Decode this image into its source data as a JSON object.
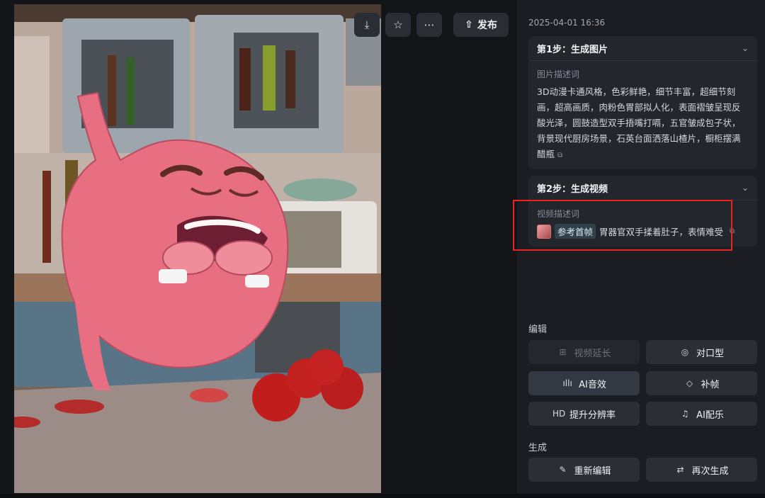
{
  "toolbar": {
    "download_icon": "download-icon",
    "favorite_icon": "star-icon",
    "more_icon": "more-icon",
    "publish_label": "发布"
  },
  "panel": {
    "timestamp": "2025-04-01 16:36",
    "step1": {
      "title": "第1步：生成图片",
      "field_label": "图片描述词",
      "prompt": "3D动漫卡通风格，色彩鲜艳，细节丰富，超细节刻画，超高画质，肉粉色胃部拟人化，表面褶皱呈现反酸光泽，圆鼓造型双手捂嘴打嗝，五官皱成包子状，背景现代厨房场景，石英台面洒落山楂片，橱柜摆满醋瓶"
    },
    "step2": {
      "title": "第2步：生成视频",
      "field_label": "视频描述词",
      "reference_chip": "参考首帧",
      "prompt": "胃器官双手揉着肚子，表情难受"
    },
    "edit_section": {
      "title": "编辑",
      "buttons": {
        "extend": "视频延长",
        "lip_sync": "对口型",
        "ai_sound": "AI音效",
        "frame_fill": "补帧",
        "upscale": "提升分辨率",
        "ai_music": "AI配乐"
      },
      "upscale_badge": "HD"
    },
    "generate_section": {
      "title": "生成",
      "buttons": {
        "reedit": "重新编辑",
        "regenerate": "再次生成"
      }
    }
  },
  "colors": {
    "panel_bg": "#1b1d22",
    "card_bg": "#23262c",
    "button_bg": "#2b2e35",
    "highlight_border": "#ee2222"
  }
}
